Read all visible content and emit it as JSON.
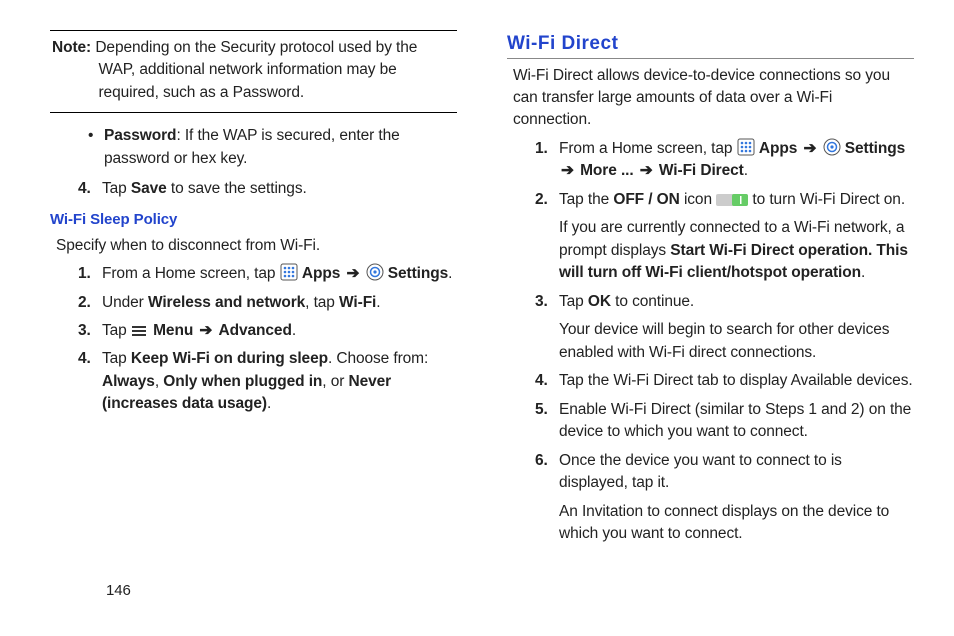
{
  "pageNumber": "146",
  "left": {
    "note": {
      "label": "Note:",
      "text": "Depending on the Security protocol used by the WAP, additional network information may be required, such as a Password."
    },
    "passwordBullet": {
      "label": "Password",
      "text": ": If the WAP is secured, enter the password or hex key."
    },
    "step4": {
      "num": "4.",
      "before": "Tap ",
      "bold": "Save",
      "after": " to save the settings."
    },
    "sleepHeading": "Wi-Fi Sleep Policy",
    "sleepPara": "Specify when to disconnect from Wi-Fi.",
    "steps": {
      "s1": {
        "num": "1.",
        "before": "From a Home screen, tap ",
        "apps": "Apps",
        "settings": "Settings",
        "arrow": "➔",
        "after": "."
      },
      "s2": {
        "num": "2.",
        "before": "Under ",
        "b1": "Wireless and network",
        "mid": ", tap ",
        "b2": "Wi-Fi",
        "after": "."
      },
      "s3": {
        "num": "3.",
        "before": "Tap ",
        "menu": "Menu",
        "arrow": "➔",
        "adv": "Advanced",
        "after": "."
      },
      "s4": {
        "num": "4.",
        "before": "Tap ",
        "b1": "Keep Wi-Fi on during sleep",
        "mid": ". Choose from: ",
        "o1": "Always",
        "sep1": ", ",
        "o2": "Only when plugged in",
        "sep2": ", or ",
        "o3": "Never (increases data usage)",
        "after": "."
      }
    }
  },
  "right": {
    "heading": "Wi-Fi Direct",
    "intro": "Wi-Fi Direct allows device-to-device connections so you can transfer large amounts of data over a Wi-Fi connection.",
    "steps": {
      "s1": {
        "num": "1.",
        "before": "From a Home screen, tap ",
        "apps": "Apps",
        "arrow": "➔",
        "settings": "Settings",
        "more": "More ...",
        "wfd": "Wi-Fi Direct",
        "after": "."
      },
      "s2": {
        "num": "2.",
        "before": "Tap the ",
        "offon": "OFF / ON",
        "mid1": " icon ",
        "mid2": " to turn Wi-Fi Direct on.",
        "p2a": "If you are currently connected to a Wi-Fi network, a prompt displays ",
        "p2b": "Start Wi-Fi Direct operation. This will turn off Wi-Fi client/hotspot operation",
        "p2c": "."
      },
      "s3": {
        "num": "3.",
        "before": "Tap ",
        "ok": "OK",
        "after": " to continue.",
        "p": "Your device will begin to search for other devices enabled with Wi-Fi direct connections."
      },
      "s4": {
        "num": "4.",
        "text": "Tap the Wi-Fi Direct tab to display Available devices."
      },
      "s5": {
        "num": "5.",
        "text": "Enable Wi-Fi Direct (similar to Steps 1 and 2) on the device to which you want to connect."
      },
      "s6": {
        "num": "6.",
        "text": "Once the device you want to connect to is displayed, tap it.",
        "p": "An Invitation to connect displays on the device to which you want to connect."
      }
    }
  }
}
